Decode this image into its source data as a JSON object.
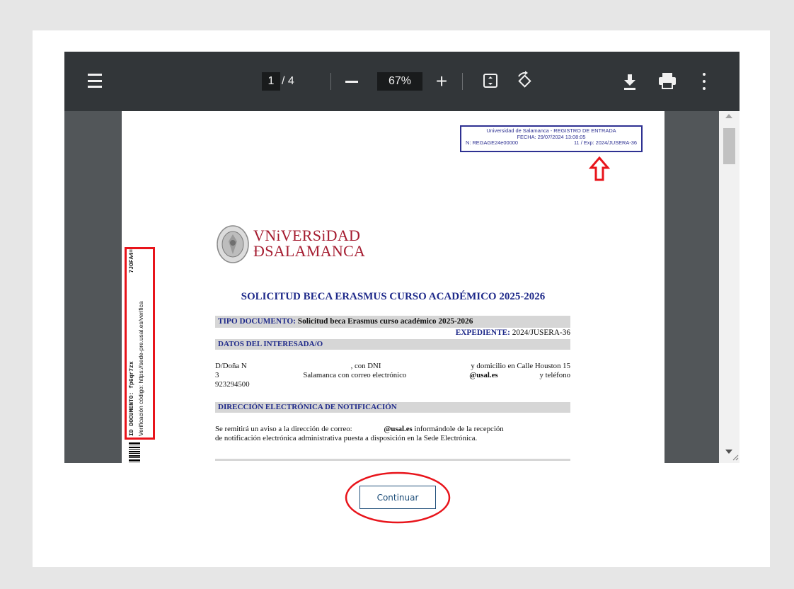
{
  "toolbar": {
    "current_page": "1",
    "total_pages": "/ 4",
    "zoom": "67%",
    "zoom_plus": "+"
  },
  "document": {
    "stamp": {
      "line1": "Universidad de Salamanca - REGISTRO DE ENTRADA",
      "line2": "FECHA: 29/07/2024 13:08:05",
      "line3_left": "N: REGAGE24e00000",
      "line3_right": "11 / Exp: 2024/JUSERA-36"
    },
    "side_text": {
      "id_label": "ID DOCUMENTO: fp6qr7zx",
      "id_suffix": "7JOFA4=",
      "verify": "Verificación código: https://sede-pre.usal.es/verifica"
    },
    "logo": {
      "line1": "VNiVERSiDAD",
      "line2": "ÐSALAMANCA"
    },
    "title": "SOLICITUD BECA ERASMUS CURSO ACADÉMICO 2025-2026",
    "tipo_label": "TIPO DOCUMENTO:",
    "tipo_value": "Solicitud beca Erasmus curso académico 2025-2026",
    "expediente_label": "EXPEDIENTE:",
    "expediente_value": "2024/JUSERA-36",
    "section_interesado": "DATOS DEL INTERESADA/O",
    "interesado_line1_a": "D/Doña N",
    "interesado_line1_b": ", con DNI",
    "interesado_line1_c": "y domicilio en Calle Houston 15",
    "interesado_line2_a": "3",
    "interesado_line2_b": "Salamanca con correo electrónico",
    "interesado_line2_c": "@usal.es",
    "interesado_line2_d": "y teléfono",
    "interesado_line3": "923294500",
    "section_notificacion": "DIRECCIÓN ELECTRÓNICA DE NOTIFICACIÓN",
    "notif_line1_a": "Se remitirá un aviso a la dirección de correo:",
    "notif_line1_b": "@usal.es",
    "notif_line1_c": "informándole de la recepción",
    "notif_line2": "de notificación electrónica administrativa puesta a disposición en la Sede Electrónica."
  },
  "continue_label": "Continuar",
  "colors": {
    "toolbar_bg": "#323639",
    "viewer_bg": "#525659",
    "annotation_red": "#e8141b",
    "stamp_blue": "#2e3192",
    "title_blue": "#1f2a8a",
    "logo_red": "#a51c30",
    "button_border": "#1e4e79"
  }
}
